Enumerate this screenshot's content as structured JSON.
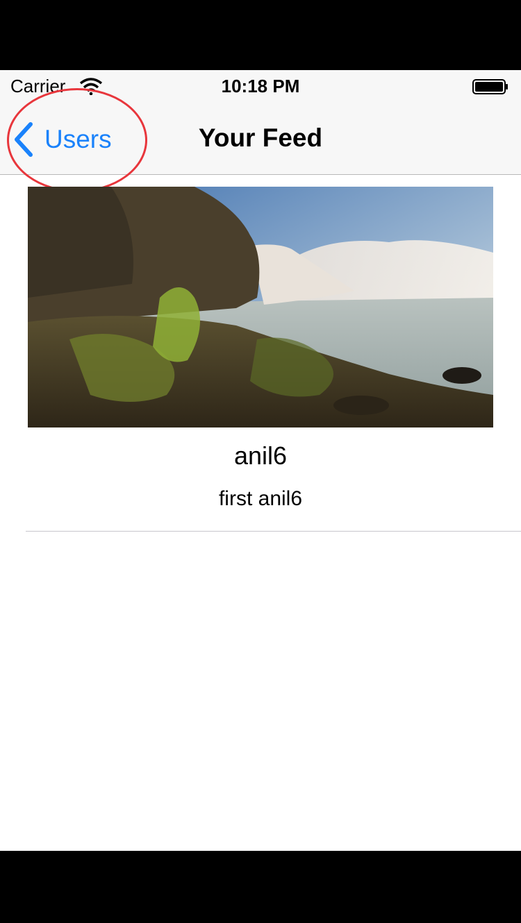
{
  "status_bar": {
    "carrier": "Carrier",
    "time": "10:18 PM"
  },
  "nav": {
    "back_label": "Users",
    "title": "Your Feed"
  },
  "feed": {
    "items": [
      {
        "author": "anil6",
        "caption": "first anil6",
        "image": "waterfall-landscape-photo"
      }
    ]
  },
  "colors": {
    "accent": "#1a82fb",
    "annotation_circle": "#e8363c"
  }
}
